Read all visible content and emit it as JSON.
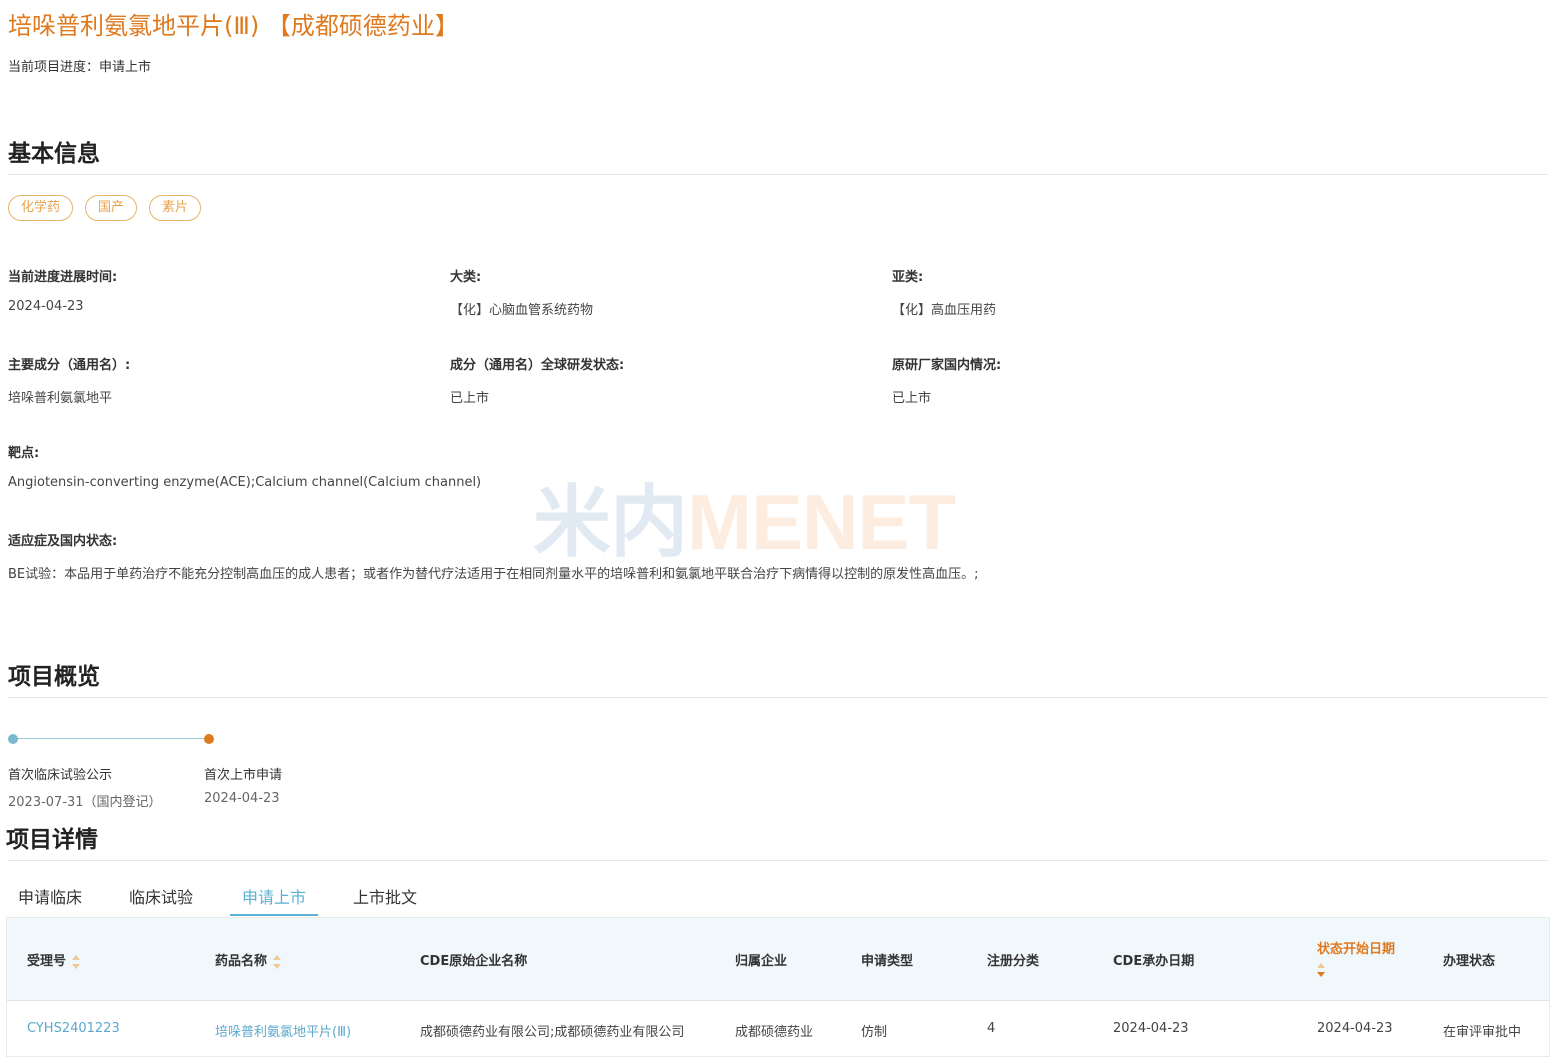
{
  "header": {
    "title": "培哚普利氨氯地平片(Ⅲ) 【成都硕德药业】",
    "progress_label": "当前项目进度：",
    "progress_value": "申请上市"
  },
  "basic_info": {
    "heading": "基本信息",
    "tags": [
      "化学药",
      "国产",
      "素片"
    ],
    "fields": {
      "progress_time": {
        "label": "当前进度进展时间:",
        "value": "2024-04-23"
      },
      "category": {
        "label": "大类:",
        "value": "【化】心脑血管系统药物"
      },
      "subcategory": {
        "label": "亚类:",
        "value": "【化】高血压用药"
      },
      "ingredient": {
        "label": "主要成分（通用名）:",
        "value": "培哚普利氨氯地平"
      },
      "global_status": {
        "label": "成分（通用名）全球研发状态:",
        "value": "已上市"
      },
      "originator_status": {
        "label": "原研厂家国内情况:",
        "value": "已上市"
      },
      "target": {
        "label": "靶点:",
        "value": "Angiotensin-converting enzyme(ACE);Calcium channel(Calcium channel)"
      },
      "indication": {
        "label": "适应症及国内状态:",
        "value": "BE试验：本品用于单药治疗不能充分控制高血压的成人患者；或者作为替代疗法适用于在相同剂量水平的培哚普利和氨氯地平联合治疗下病情得以控制的原发性高血压。;"
      }
    }
  },
  "watermark": {
    "part_a": "米内",
    "part_b": "MENET"
  },
  "overview": {
    "heading": "项目概览",
    "milestones": [
      {
        "label": "首次临床试验公示",
        "date": "2023-07-31（国内登记）"
      },
      {
        "label": "首次上市申请",
        "date": "2024-04-23"
      }
    ]
  },
  "details": {
    "heading": "项目详情",
    "tabs": [
      "申请临床",
      "临床试验",
      "申请上市",
      "上市批文"
    ],
    "active_tab": "申请上市",
    "columns": [
      "受理号",
      "药品名称",
      "CDE原始企业名称",
      "归属企业",
      "申请类型",
      "注册分类",
      "CDE承办日期",
      "状态开始日期",
      "办理状态"
    ],
    "rows": [
      [
        "CYHS2401223",
        "培哚普利氨氯地平片(Ⅲ)",
        "成都硕德药业有限公司;成都硕德药业有限公司",
        "成都硕德药业",
        "仿制",
        "4",
        "2024-04-23",
        "2024-04-23",
        "在审评审批中"
      ]
    ]
  },
  "colors": {
    "accent": "#e07a1f",
    "link": "#5aa9cc",
    "tag": "#e8a24a",
    "header_bg": "#f1f8fb"
  }
}
